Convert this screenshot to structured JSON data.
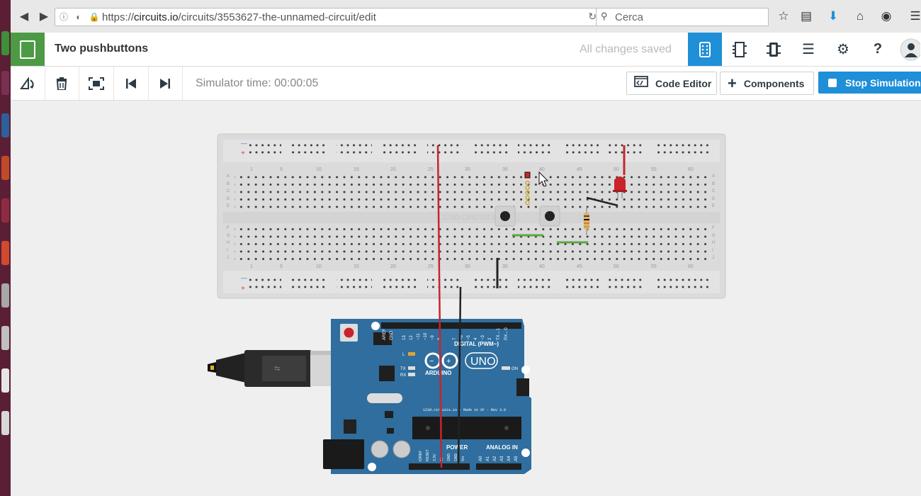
{
  "browser": {
    "url_prefix": "https://",
    "url_domain": "circuits.io",
    "url_path": "/circuits/3553627-the-unnamed-circuit/edit",
    "search_placeholder": "Cerca"
  },
  "header": {
    "title": "Two pushbuttons",
    "save_status": "All changes saved"
  },
  "toolbar": {
    "simulator_time": "Simulator time: 00:00:05",
    "code_editor_label": "Code Editor",
    "components_label": "Components",
    "stop_simulation_label": "Stop Simulation"
  },
  "breadboard": {
    "column_numbers": [
      "1",
      "5",
      "10",
      "15",
      "20",
      "25",
      "30",
      "35",
      "40",
      "45",
      "50",
      "55",
      "60"
    ],
    "row_letters_top": [
      "A",
      "B",
      "C",
      "D",
      "E"
    ],
    "row_letters_bottom": [
      "F",
      "G",
      "H",
      "I",
      "J"
    ],
    "watermark": "123D CIRCUITS.IO"
  },
  "arduino": {
    "brand": "ARDUINO",
    "model": "UNO",
    "digital_label": "DIGITAL (PWM~)",
    "power_label": "POWER",
    "analog_label": "ANALOG IN",
    "on_label": "ON",
    "tx_label": "TX",
    "rx_label": "RX",
    "l_label": "L",
    "footer_text": "123d.circuits.io - Made in SF - Rev 3.0",
    "digital_pins": [
      "AREF",
      "GND",
      "13",
      "12",
      "~11",
      "~10",
      "~9",
      "8",
      "7",
      "~6",
      "~5",
      "4",
      "~3",
      "2",
      "TX→1",
      "RX←0"
    ],
    "power_pins": [
      "IOREF",
      "RESET",
      "3.3V",
      "5V",
      "GND",
      "GND",
      "Vin"
    ],
    "analog_pins": [
      "A0",
      "A1",
      "A2",
      "A3",
      "A4",
      "A5"
    ]
  },
  "colors": {
    "accent": "#1f8fd8",
    "logo_green": "#4d9a45",
    "wire_red": "#c8242c",
    "wire_black": "#222222",
    "wire_green": "#5da845",
    "arduino_blue": "#2f6e9e"
  }
}
